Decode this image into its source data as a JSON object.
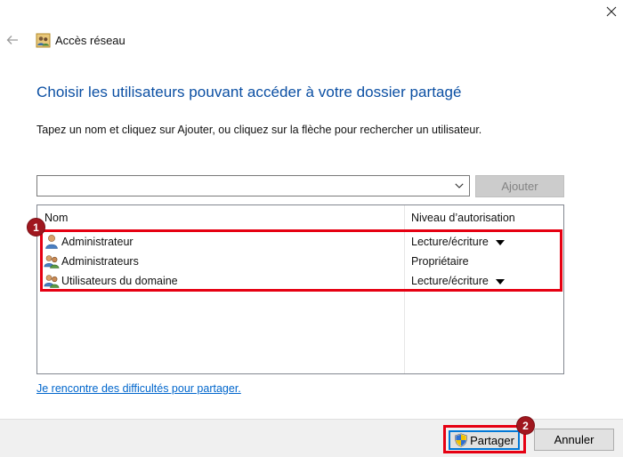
{
  "window": {
    "title": "Accès réseau",
    "close_icon": "close-icon",
    "back_icon": "back-arrow-icon",
    "title_icon": "network-users-icon"
  },
  "main": {
    "heading": "Choisir les utilisateurs pouvant accéder à votre dossier partagé",
    "instructions": "Tapez un nom et cliquez sur Ajouter, ou cliquez sur la flèche pour rechercher un utilisateur."
  },
  "user_picker": {
    "value": "",
    "add_label": "Ajouter"
  },
  "list": {
    "columns": [
      "Nom",
      "Niveau d’autorisation"
    ],
    "rows": [
      {
        "name": "Administrateur",
        "level": "Lecture/écriture",
        "has_dropdown": true,
        "icon": "single-user-icon"
      },
      {
        "name": "Administrateurs",
        "level": "Propriétaire",
        "has_dropdown": false,
        "icon": "user-group-icon"
      },
      {
        "name": "Utilisateurs du domaine",
        "level": "Lecture/écriture",
        "has_dropdown": true,
        "icon": "user-group-icon"
      }
    ]
  },
  "annotations": {
    "badge_1": "1",
    "badge_2": "2",
    "highlight_color": "#e60012",
    "badge_color": "#a0171f"
  },
  "help_link": "Je rencontre des difficultés pour partager.",
  "footer": {
    "share_label": "Partager",
    "cancel_label": "Annuler"
  },
  "colors": {
    "heading": "#0b4fa3",
    "link": "#0066cc",
    "focus": "#0078d7"
  }
}
